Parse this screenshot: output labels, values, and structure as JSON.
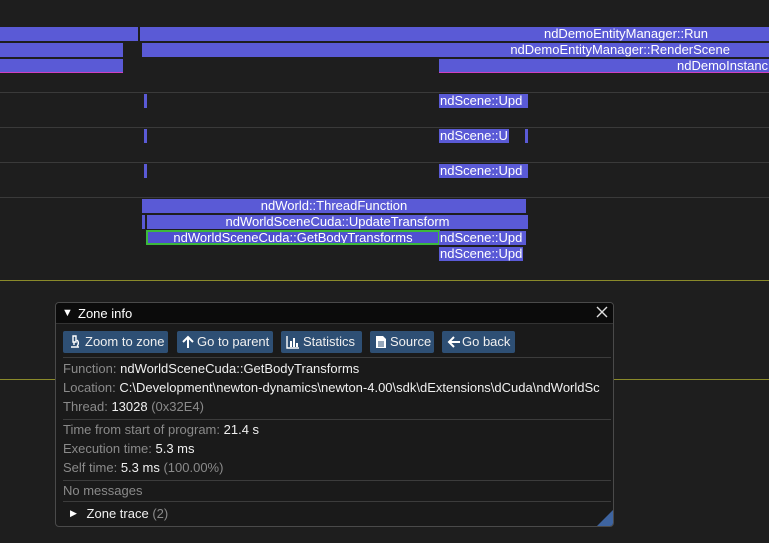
{
  "timeline": {
    "zones": {
      "run": "ndDemoEntityManager::Run",
      "render_scene": "ndDemoEntityManager::RenderScene",
      "demo_instance": "ndDemoInstanc",
      "scene_upd_1": "ndScene::Upd",
      "scene_u_2": "ndScene::U",
      "scene_upd_3": "ndScene::Upd",
      "thread_function": "ndWorld::ThreadFunction",
      "update_transform": "ndWorldSceneCuda::UpdateTransform",
      "get_body_transforms": "ndWorldSceneCuda::GetBodyTransforms",
      "scene_upd_4": "ndScene::Upd",
      "scene_upd_5": "ndScene::Upd"
    }
  },
  "zone_info": {
    "title": "Zone info",
    "buttons": {
      "zoom": "Zoom to zone",
      "parent": "Go to parent",
      "statistics": "Statistics",
      "source": "Source",
      "back": "Go back"
    },
    "function_label": "Function:",
    "function_value": "ndWorldSceneCuda::GetBodyTransforms",
    "location_label": "Location:",
    "location_value": "C:\\Development\\newton-dynamics\\newton-4.00\\sdk\\dExtensions\\dCuda\\ndWorldSc",
    "thread_label": "Thread:",
    "thread_value": "13028",
    "thread_hex": "(0x32E4)",
    "time_from_start_label": "Time from start of program:",
    "time_from_start_value": "21.4 s",
    "execution_label": "Execution time:",
    "execution_value": "5.3 ms",
    "self_label": "Self time:",
    "self_value": "5.3 ms",
    "self_pct": "(100.00%)",
    "no_messages": "No messages",
    "zone_trace_label": "Zone trace",
    "zone_trace_count": "(2)"
  },
  "colors": {
    "background": "#1e1e1e",
    "zone": "#5a5ad6",
    "selected_border": "#3cb83c",
    "button": "#2e4f74",
    "frame_line": "#8a8a2a"
  }
}
